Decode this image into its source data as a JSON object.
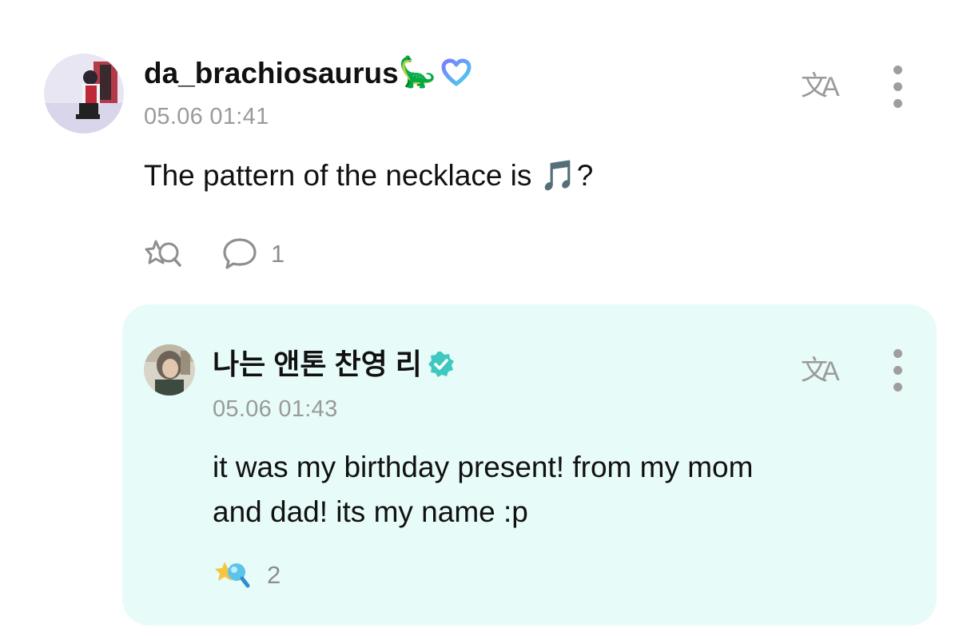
{
  "comment": {
    "username": "da_brachiosaurus",
    "username_emoji": "🦕",
    "timestamp": "05.06 01:41",
    "text": "The pattern of the necklace is 🎵?",
    "reply_count": "1",
    "icons": {
      "avatar": "avatar",
      "badge": "heart-badge-icon",
      "translate": "translate-icon",
      "more": "more-vertical-icon",
      "react": "react-icon",
      "comment": "comment-icon"
    }
  },
  "reply": {
    "username": "나는 앤톤 찬영 리",
    "timestamp": "05.06 01:43",
    "text_line1": "it was my birthday present! from my mom",
    "text_line2": "and dad! its my name :p",
    "reaction_count": "2",
    "icons": {
      "avatar": "avatar",
      "badge": "verified-badge-icon",
      "translate": "translate-icon",
      "more": "more-vertical-icon",
      "reaction": "sparkle-reaction-icon"
    }
  },
  "colors": {
    "reply_background": "#e7fbf8",
    "verified_badge": "#3ec9c0",
    "heart_badge_start": "#7a7cff",
    "heart_badge_end": "#4ad0e8"
  }
}
